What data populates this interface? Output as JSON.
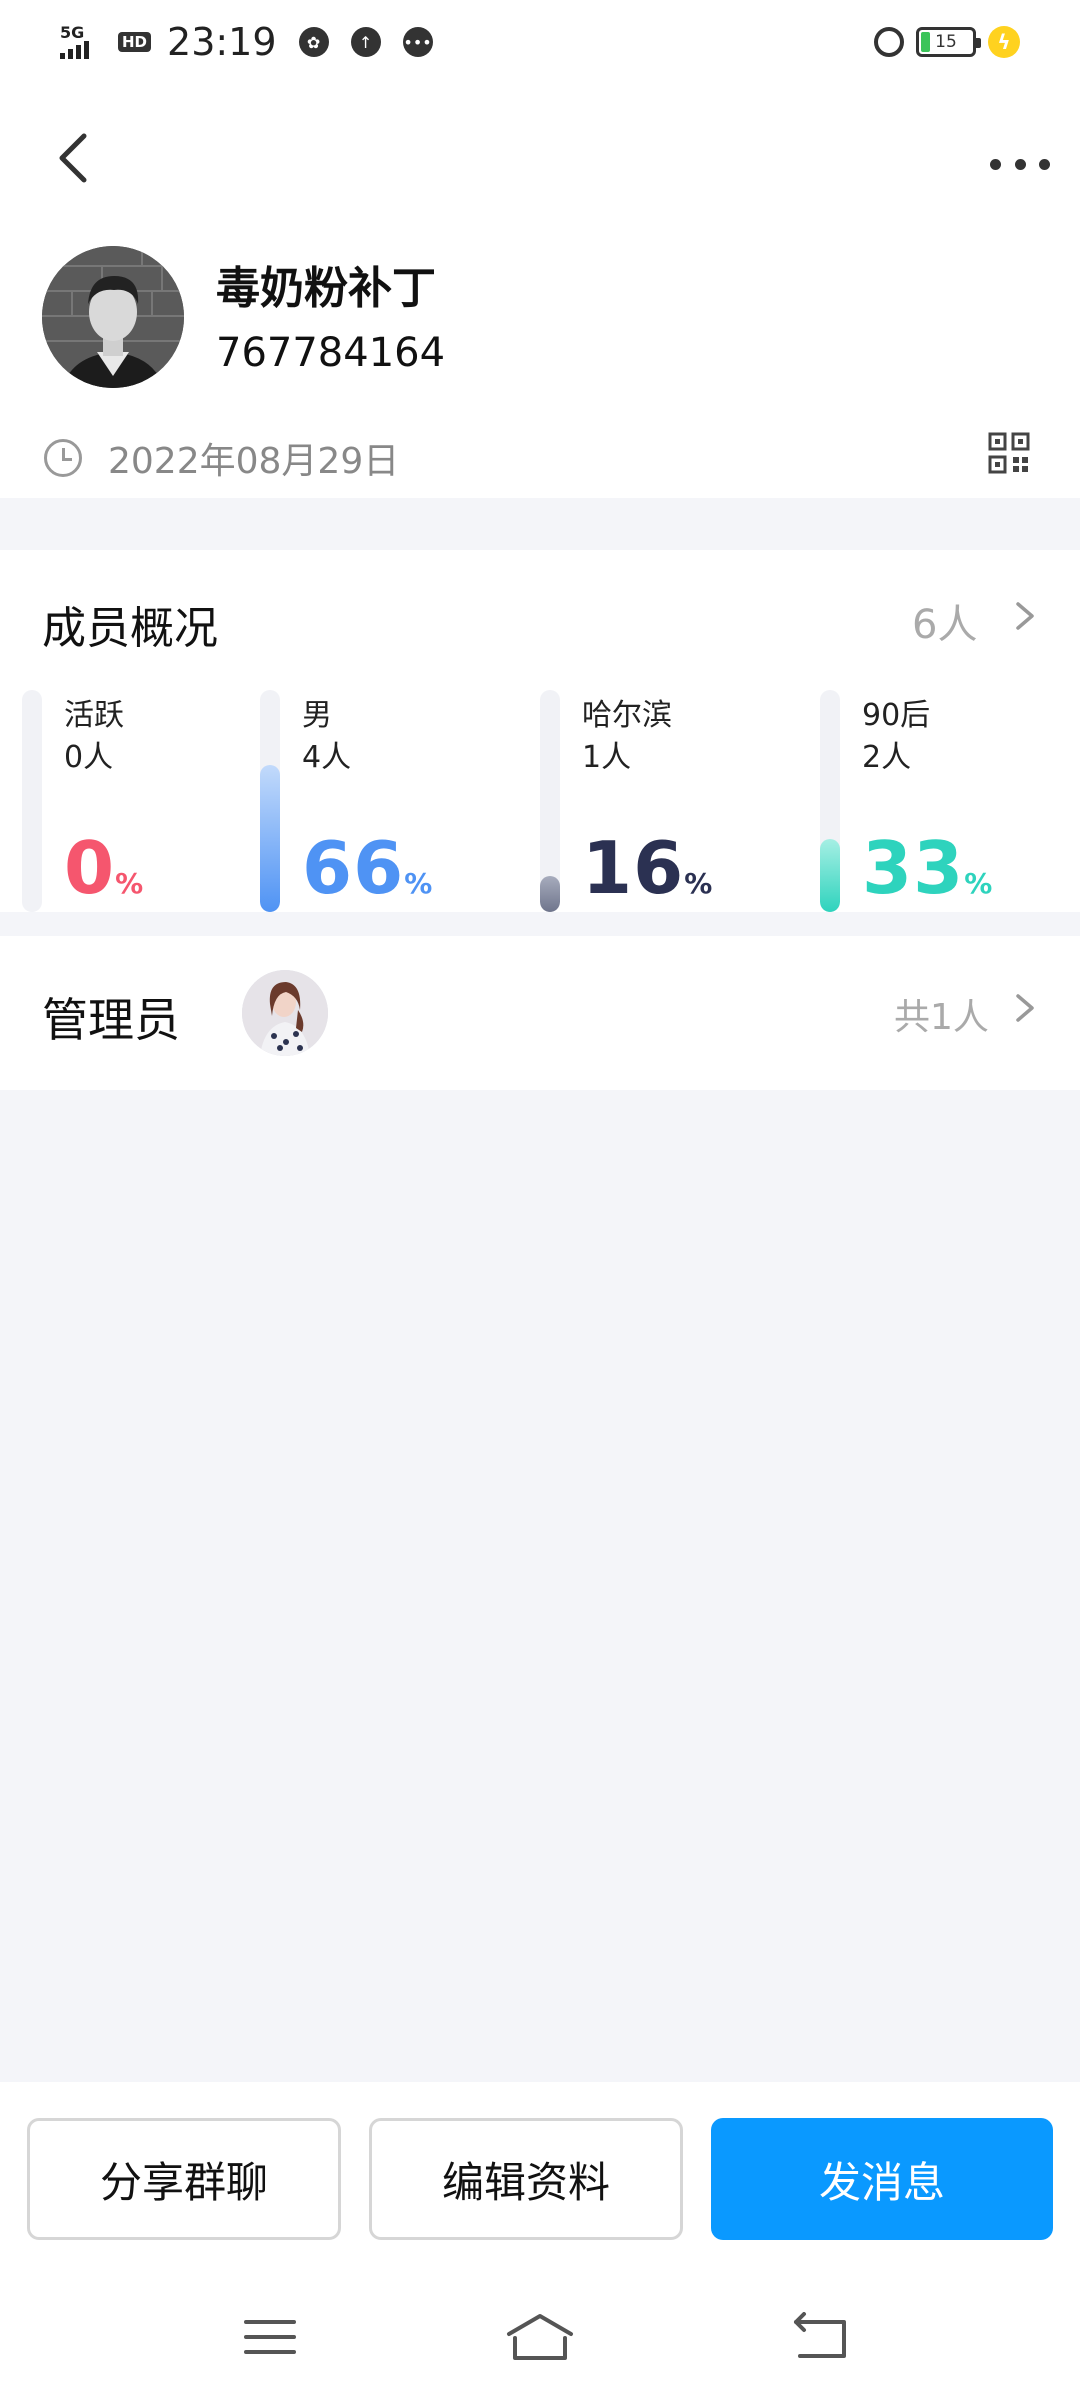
{
  "status_bar": {
    "network": "5G",
    "hd": "HD",
    "time": "23:19",
    "battery": "15"
  },
  "group": {
    "name": "毒奶粉补丁",
    "id": "767784164",
    "created": "2022年08月29日"
  },
  "overview": {
    "title": "成员概况",
    "total": "6人",
    "stats": [
      {
        "label": "活跃",
        "count": "0人",
        "percent": "0",
        "unit": "%",
        "fraction": 0.0,
        "color": "#f5566e"
      },
      {
        "label": "男",
        "count": "4人",
        "percent": "66",
        "unit": "%",
        "fraction": 0.66,
        "color": "#4f93f4"
      },
      {
        "label": "哈尔滨",
        "count": "1人",
        "percent": "16",
        "unit": "%",
        "fraction": 0.16,
        "color": "#2b3152"
      },
      {
        "label": "90后",
        "count": "2人",
        "percent": "33",
        "unit": "%",
        "fraction": 0.33,
        "color": "#2ed3bd"
      }
    ]
  },
  "admin": {
    "title": "管理员",
    "count": "共1人"
  },
  "actions": {
    "share": "分享群聊",
    "edit": "编辑资料",
    "message": "发消息"
  },
  "colors": {
    "primary": "#0a99ff",
    "background": "#f4f5f9"
  }
}
